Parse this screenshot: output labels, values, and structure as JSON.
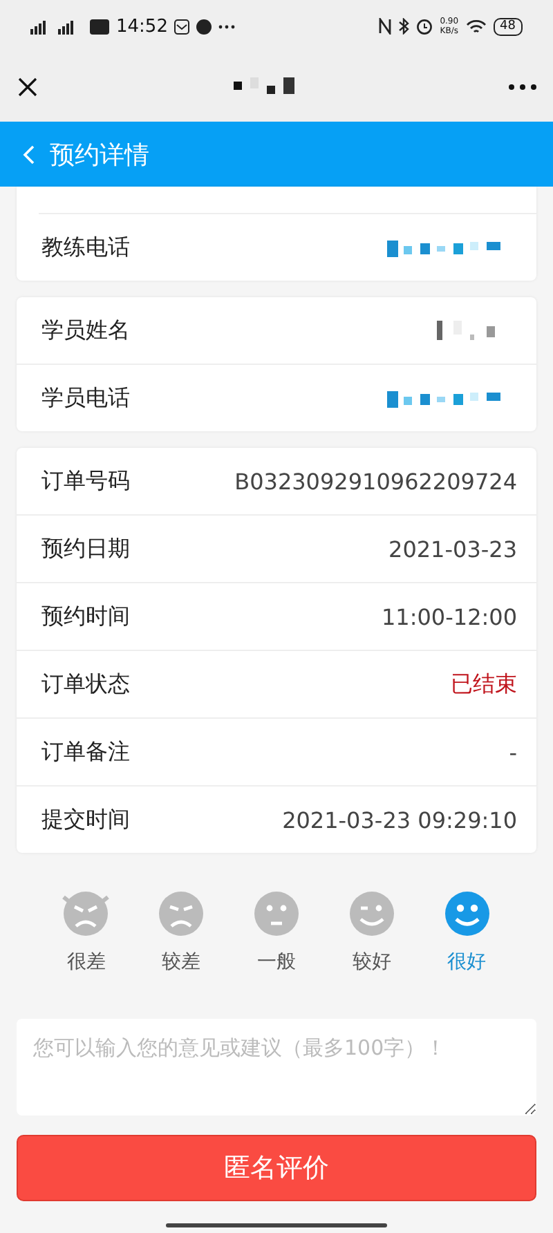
{
  "status_bar": {
    "time": "14:52",
    "speed": "0.90",
    "speed_unit": "KB/s",
    "battery": "48"
  },
  "header": {
    "title": "预约详情"
  },
  "cards": [
    {
      "cut_top": true,
      "rows": [
        {
          "label": "教练电话",
          "kind": "redacted"
        }
      ]
    },
    {
      "cut_top": false,
      "rows": [
        {
          "label": "学员姓名",
          "kind": "redacted"
        },
        {
          "label": "学员电话",
          "kind": "redacted"
        }
      ]
    },
    {
      "cut_top": false,
      "rows": [
        {
          "label": "订单号码",
          "kind": "text",
          "value": "B0323092910962209724"
        },
        {
          "label": "预约日期",
          "kind": "text",
          "value": "2021-03-23"
        },
        {
          "label": "预约时间",
          "kind": "text",
          "value": "11:00-12:00"
        },
        {
          "label": "订单状态",
          "kind": "alert",
          "value": "已结束"
        },
        {
          "label": "订单备注",
          "kind": "text",
          "value": "-"
        },
        {
          "label": "提交时间",
          "kind": "text",
          "value": "2021-03-23 09:29:10"
        }
      ]
    }
  ],
  "ratings": [
    {
      "label": "很差",
      "kind": "angry",
      "selected": false
    },
    {
      "label": "较差",
      "kind": "sad",
      "selected": false
    },
    {
      "label": "一般",
      "kind": "neutral",
      "selected": false
    },
    {
      "label": "较好",
      "kind": "wink",
      "selected": false
    },
    {
      "label": "很好",
      "kind": "happy",
      "selected": true
    }
  ],
  "comment": {
    "placeholder": "您可以输入您的意见或建议（最多100字）！"
  },
  "submit": {
    "label": "匿名评价"
  }
}
